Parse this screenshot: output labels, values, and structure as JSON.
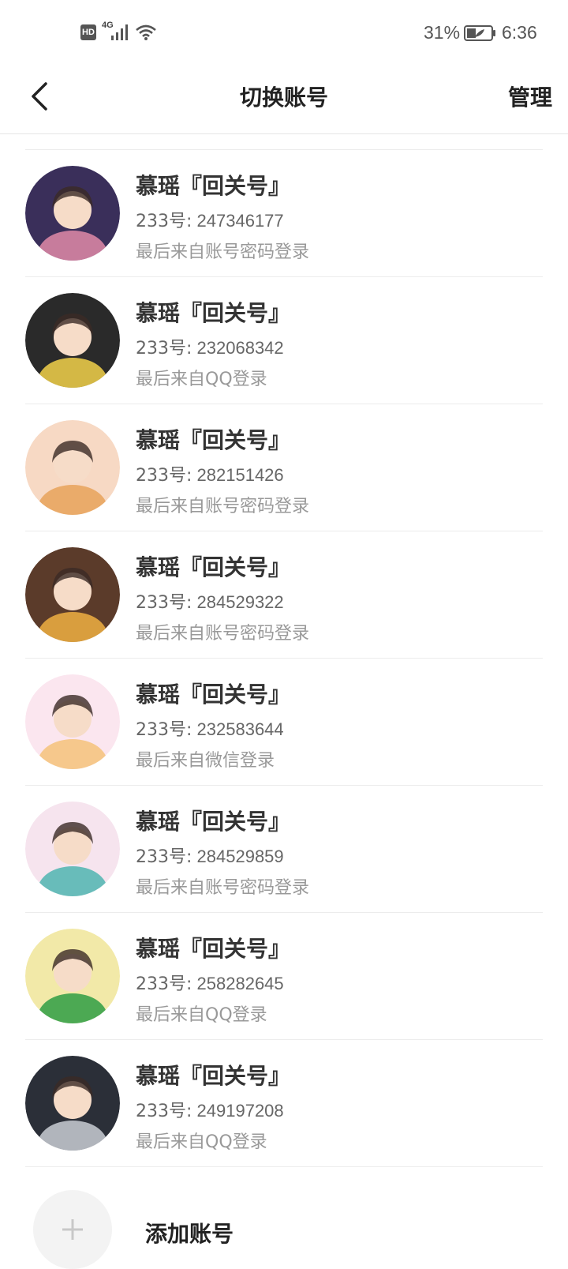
{
  "status_bar": {
    "hd": "HD",
    "network": "4G",
    "battery": "31%",
    "time": "6:36"
  },
  "header": {
    "title": "切换账号",
    "manage": "管理"
  },
  "accounts": [
    {
      "name": "慕瑶『回关号』",
      "id_prefix": "233号:",
      "id": "247346177",
      "source": "最后来自账号密码登录",
      "avatar_color": "#3a2f5a",
      "avatar_accent": "#e08aa8"
    },
    {
      "name": "慕瑶『回关号』",
      "id_prefix": "233号:",
      "id": "232068342",
      "source": "最后来自QQ登录",
      "avatar_color": "#2a2a2a",
      "avatar_accent": "#f2d14a"
    },
    {
      "name": "慕瑶『回关号』",
      "id_prefix": "233号:",
      "id": "282151426",
      "source": "最后来自账号密码登录",
      "avatar_color": "#f7d9c4",
      "avatar_accent": "#e8a25a"
    },
    {
      "name": "慕瑶『回关号』",
      "id_prefix": "233号:",
      "id": "284529322",
      "source": "最后来自账号密码登录",
      "avatar_color": "#5b3b2a",
      "avatar_accent": "#f0b042"
    },
    {
      "name": "慕瑶『回关号』",
      "id_prefix": "233号:",
      "id": "232583644",
      "source": "最后来自微信登录",
      "avatar_color": "#fbe6ef",
      "avatar_accent": "#f4c27a"
    },
    {
      "name": "慕瑶『回关号』",
      "id_prefix": "233号:",
      "id": "284529859",
      "source": "最后来自账号密码登录",
      "avatar_color": "#f6e4ee",
      "avatar_accent": "#4fb5b0"
    },
    {
      "name": "慕瑶『回关号』",
      "id_prefix": "233号:",
      "id": "258282645",
      "source": "最后来自QQ登录",
      "avatar_color": "#f2e9a8",
      "avatar_accent": "#2f9e44"
    },
    {
      "name": "慕瑶『回关号』",
      "id_prefix": "233号:",
      "id": "249197208",
      "source": "最后来自QQ登录",
      "avatar_color": "#2b2f38",
      "avatar_accent": "#c9ccd3"
    }
  ],
  "add_account": {
    "label": "添加账号"
  }
}
